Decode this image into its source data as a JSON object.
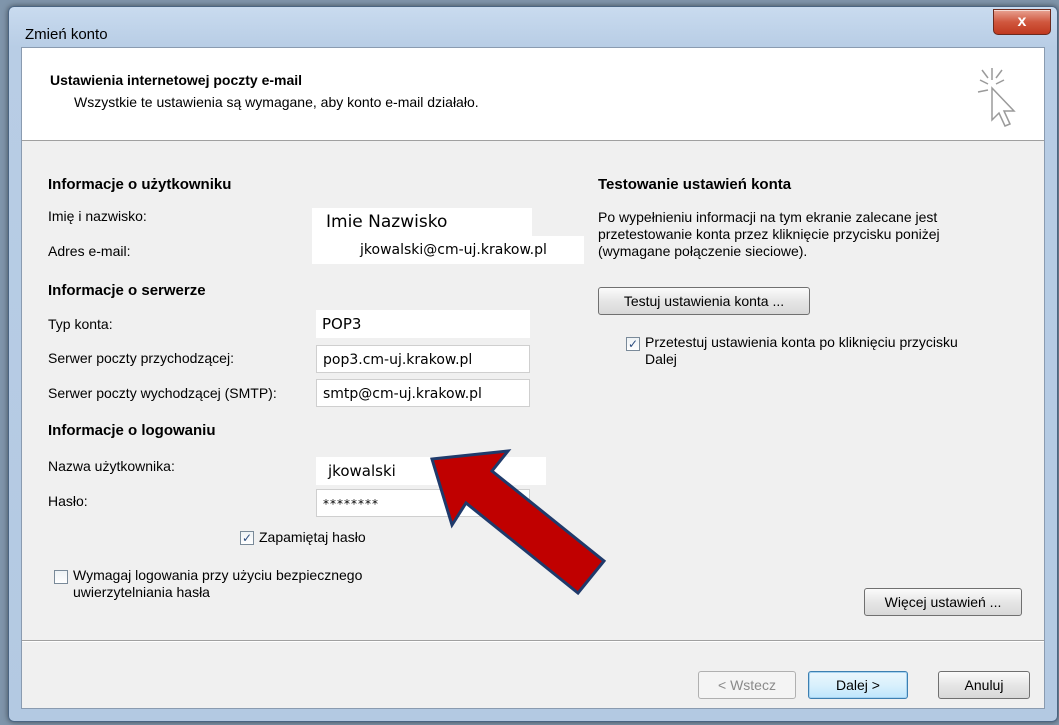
{
  "window": {
    "title": "Zmień konto",
    "close_label": "x"
  },
  "header": {
    "title": "Ustawienia internetowej poczty e-mail",
    "subtitle": "Wszystkie te ustawienia są wymagane, aby konto e-mail działało."
  },
  "user_info": {
    "heading": "Informacje o użytkowniku",
    "name_label": "Imię i nazwisko:",
    "name_value": "Imie Nazwisko",
    "email_label": "Adres e-mail:",
    "email_value": "jkowalski@cm-uj.krakow.pl"
  },
  "server_info": {
    "heading": "Informacje o serwerze",
    "account_type_label": "Typ konta:",
    "account_type_value": "POP3",
    "incoming_label": "Serwer poczty przychodzącej:",
    "incoming_value": "pop3.cm-uj.krakow.pl",
    "outgoing_label": "Serwer poczty wychodzącej (SMTP):",
    "outgoing_value": "smtp@cm-uj.krakow.pl"
  },
  "login_info": {
    "heading": "Informacje o logowaniu",
    "username_label": "Nazwa użytkownika:",
    "username_value": "jkowalski",
    "password_label": "Hasło:",
    "password_value": "********",
    "remember_label": "Zapamiętaj hasło",
    "remember_checked": true,
    "spa_label_line1": "Wymagaj logowania przy użyciu bezpiecznego",
    "spa_label_line2": "uwierzytelniania hasła",
    "spa_checked": false
  },
  "testing": {
    "heading": "Testowanie ustawień konta",
    "desc_line1": "Po wypełnieniu informacji na tym ekranie zalecane jest",
    "desc_line2": "przetestowanie konta przez kliknięcie przycisku poniżej",
    "desc_line3": "(wymagane połączenie sieciowe).",
    "test_button": "Testuj ustawienia konta ...",
    "auto_test_line1": "Przetestuj ustawienia konta po kliknięciu przycisku",
    "auto_test_line2": "Dalej",
    "auto_test_checked": true,
    "more_settings_button": "Więcej ustawień ..."
  },
  "footer": {
    "back_button": "< Wstecz",
    "next_button": "Dalej >",
    "cancel_button": "Anuluj"
  },
  "colors": {
    "arrow_fill": "#c00000",
    "arrow_stroke": "#1f3a6b"
  }
}
